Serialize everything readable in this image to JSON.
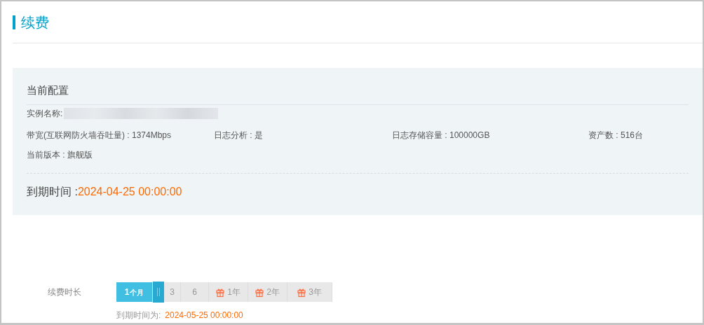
{
  "page_title": "续费",
  "config": {
    "title": "当前配置",
    "instance_label": "实例名称:",
    "specs": [
      {
        "text": "带宽(互联网防火墙吞吐量) : 1374Mbps"
      },
      {
        "text": "日志分析 : 是"
      },
      {
        "text": "日志存储容量 : 100000GB"
      },
      {
        "text": "资产数 : 516台"
      },
      {
        "text": "当前版本 : 旗舰版"
      }
    ],
    "expiry_label": "到期时间 :",
    "expiry_value": "2024-04-25 00:00:00"
  },
  "renewal": {
    "label": "续费时长",
    "options": [
      {
        "kind": "month",
        "label": "1",
        "unit": "个月",
        "selected": true
      },
      {
        "kind": "month",
        "label": "3",
        "selected": false
      },
      {
        "kind": "month",
        "label": "6",
        "selected": false
      },
      {
        "kind": "year",
        "label": "1年",
        "selected": false
      },
      {
        "kind": "year",
        "label": "2年",
        "selected": false
      },
      {
        "kind": "year",
        "label": "3年",
        "selected": false
      }
    ],
    "new_expiry_label": "到期时间为:",
    "new_expiry_value": "2024-05-25 00:00:00"
  }
}
